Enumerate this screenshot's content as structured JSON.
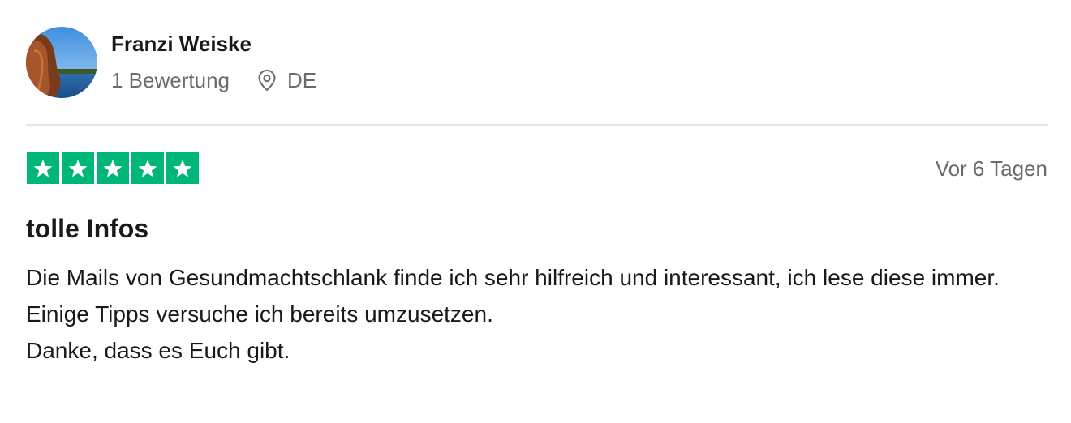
{
  "reviewer": {
    "name": "Franzi Weiske",
    "review_count": "1 Bewertung",
    "country": "DE",
    "location_icon": "location-pin-icon",
    "avatar_icon": "avatar-photo"
  },
  "review": {
    "rating": 5,
    "rating_max": 5,
    "star_color": "#00b67a",
    "date": "Vor 6 Tagen",
    "title": "tolle Infos",
    "body_lines": [
      "Die Mails von Gesundmachtschlank finde ich sehr hilfreich und interessant, ich lese diese immer.",
      "Einige Tipps versuche ich bereits umzusetzen.",
      "Danke, dass es Euch gibt."
    ]
  }
}
